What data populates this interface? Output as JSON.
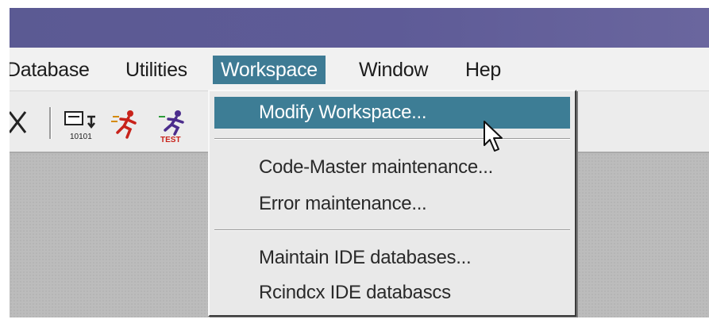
{
  "menubar": {
    "items": [
      {
        "label": "Database"
      },
      {
        "label": "Utilities"
      },
      {
        "label": "Workspace",
        "active": true
      },
      {
        "label": "Window"
      },
      {
        "label": "Hep"
      }
    ]
  },
  "toolbar": {
    "icons": [
      "close-icon",
      "binary-data-icon",
      "runner-icon",
      "runner-test-icon"
    ],
    "icon_captions": {
      "binary": "10101",
      "test": "TEST"
    }
  },
  "dropdown": {
    "items": [
      {
        "label": "Modify Workspace...",
        "highlighted": true
      },
      {
        "label": "Code-Master maintenance..."
      },
      {
        "label": "Error maintenance..."
      },
      {
        "label": "Maintain IDE databases..."
      },
      {
        "label": "Rcindcx IDE databascs"
      }
    ]
  },
  "colors": {
    "titlebar": "#5b5a93",
    "highlight": "#3d7d95",
    "menu_bg": "#e9e9e9"
  }
}
